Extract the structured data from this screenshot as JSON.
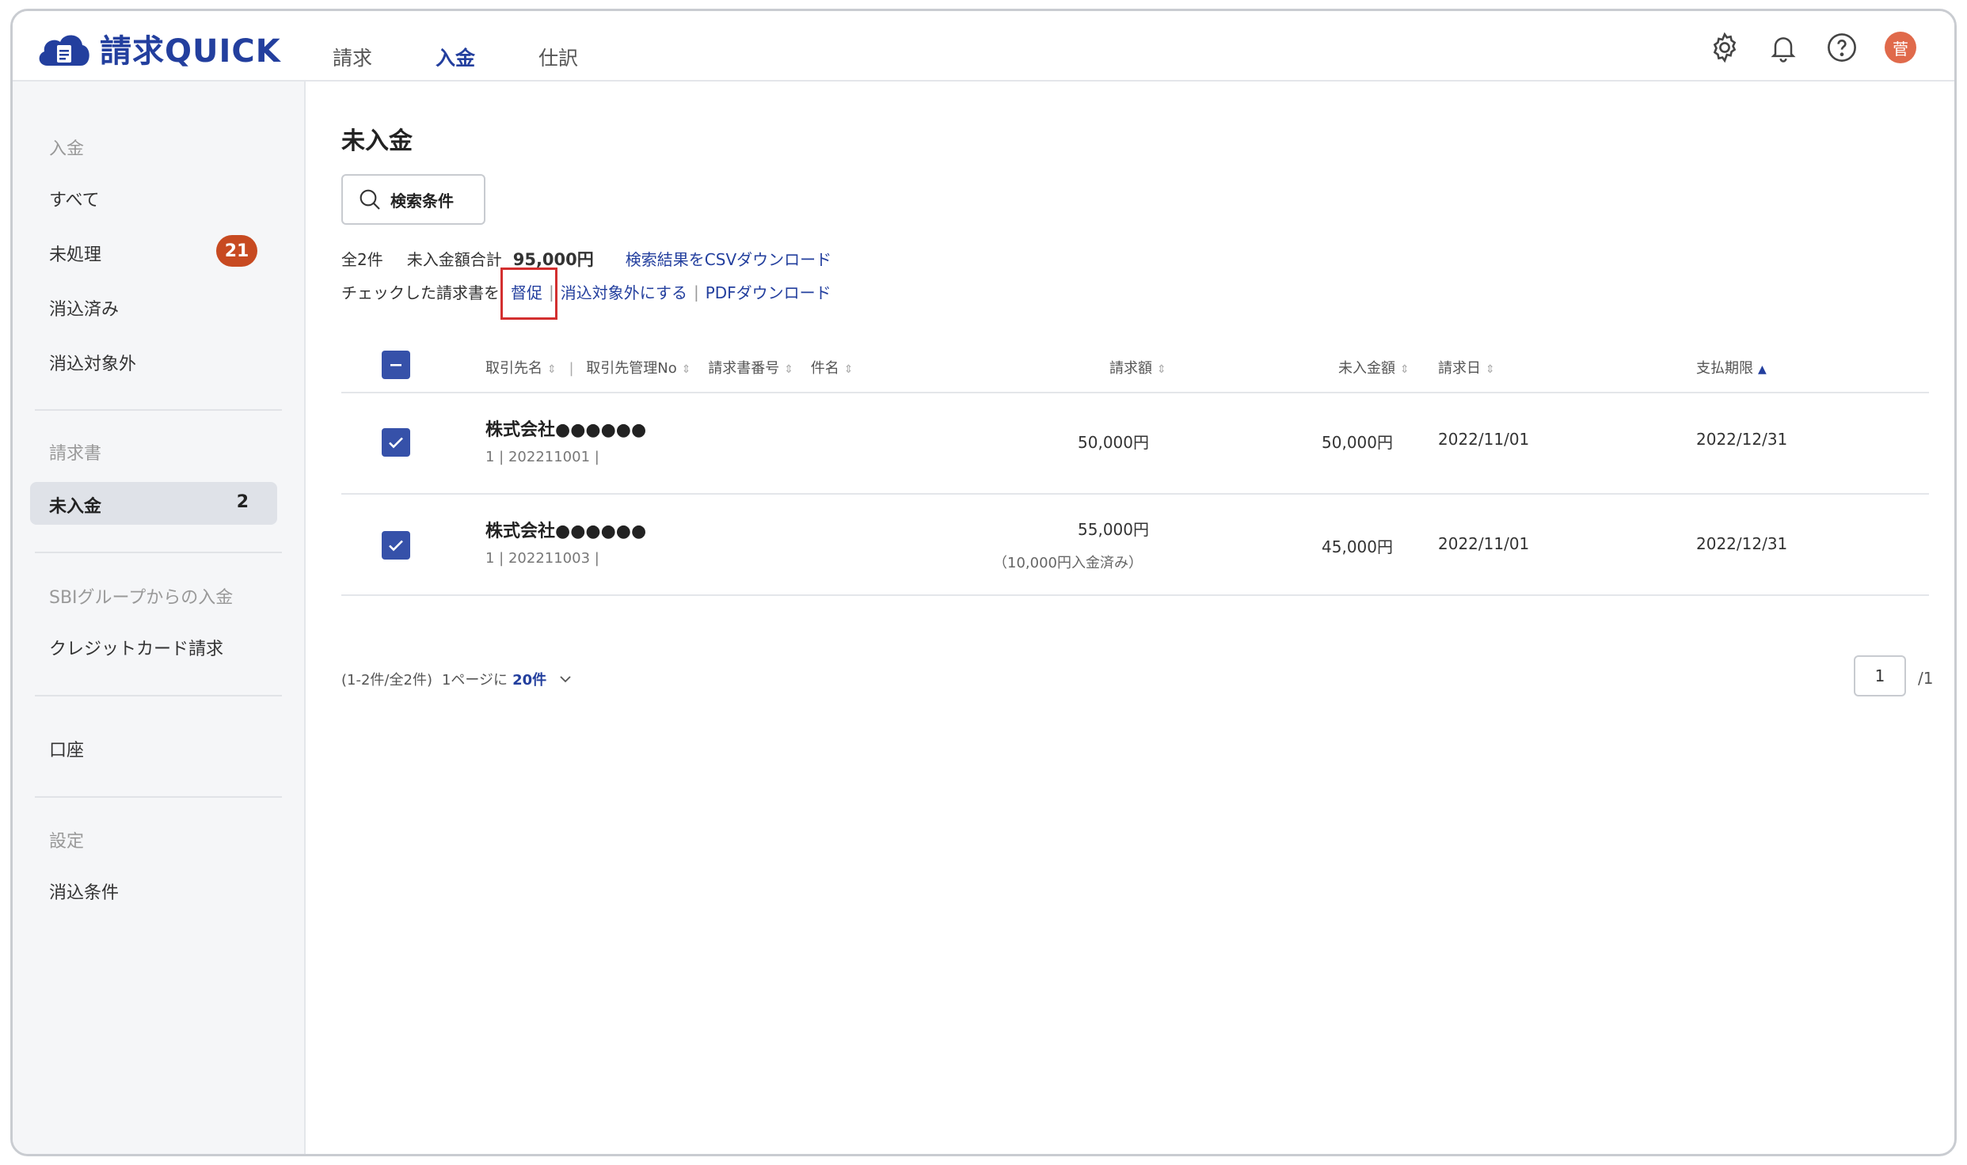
{
  "app": {
    "name": "請求QUICK",
    "logo_icon": "cloud-document-icon"
  },
  "header": {
    "nav": [
      {
        "label": "請求",
        "active": false
      },
      {
        "label": "入金",
        "active": true
      },
      {
        "label": "仕訳",
        "active": false
      }
    ],
    "avatar_text": "菅",
    "icons": [
      "gear-icon",
      "bell-icon",
      "help-icon"
    ]
  },
  "sidebar": {
    "section_payment": "入金",
    "all": "すべて",
    "unprocessed": "未処理",
    "unprocessed_badge": "21",
    "reconciled": "消込済み",
    "excluded": "消込対象外",
    "section_invoice": "請求書",
    "unpaid": "未入金",
    "unpaid_count": "2",
    "sbi_section": "SBIグループからの入金",
    "credit_card": "クレジットカード請求",
    "account": "口座",
    "section_settings": "設定",
    "reconcile_conditions": "消込条件"
  },
  "main": {
    "title": "未入金",
    "search_button": "検索条件",
    "summary": {
      "total_count": "全2件",
      "unpaid_total_label": "未入金額合計",
      "unpaid_total_value": "95,000円",
      "csv_link": "検索結果をCSVダウンロード"
    },
    "actions": {
      "prefix": "チェックした請求書を",
      "remind": "督促",
      "exclude": "消込対象外にする",
      "pdf": "PDFダウンロード",
      "separator": "|"
    },
    "table": {
      "headers": {
        "client": "取引先名",
        "client_no": "取引先管理No",
        "invoice_no": "請求書番号",
        "subject": "件名",
        "amount": "請求額",
        "unpaid": "未入金額",
        "date": "請求日",
        "due": "支払期限"
      },
      "sep": "|",
      "rows": [
        {
          "client": "株式会社●●●●●●",
          "sub": "1 | 202211001 |",
          "amount": "50,000円",
          "note": "",
          "unpaid": "50,000円",
          "date": "2022/11/01",
          "due": "2022/12/31"
        },
        {
          "client": "株式会社●●●●●●",
          "sub": "1 | 202211003 |",
          "amount": "55,000円",
          "note": "（10,000円入金済み）",
          "unpaid": "45,000円",
          "date": "2022/11/01",
          "due": "2022/12/31"
        }
      ]
    },
    "pager": {
      "range": "(1-2件/全2件)",
      "per_page_label": "1ページに",
      "per_page_value": "20件",
      "current_page": "1",
      "total_pages": "/1"
    }
  },
  "colors": {
    "brand": "#233f9e",
    "badge": "#c74a21",
    "highlight": "#d32f2f",
    "checkbox": "#3651a9"
  }
}
